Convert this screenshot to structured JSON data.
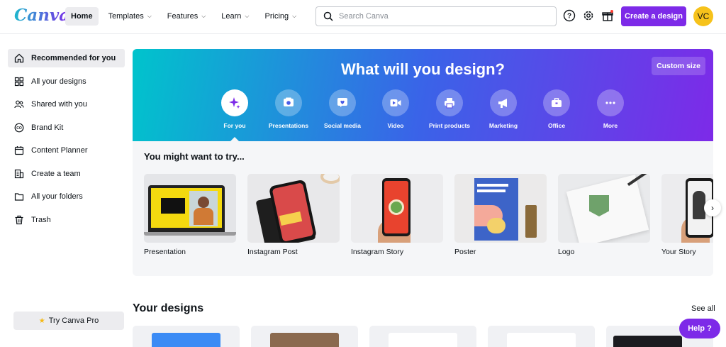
{
  "app": {
    "logo": "Canva"
  },
  "nav": [
    {
      "label": "Home",
      "dropdown": false
    },
    {
      "label": "Templates",
      "dropdown": true
    },
    {
      "label": "Features",
      "dropdown": true
    },
    {
      "label": "Learn",
      "dropdown": true
    },
    {
      "label": "Pricing",
      "dropdown": true
    }
  ],
  "search": {
    "placeholder": "Search Canva"
  },
  "header": {
    "create_label": "Create a design",
    "avatar_initials": "VC"
  },
  "sidebar": {
    "items": [
      {
        "label": "Recommended for you",
        "icon": "home-icon"
      },
      {
        "label": "All your designs",
        "icon": "grid-icon"
      },
      {
        "label": "Shared with you",
        "icon": "users-icon"
      },
      {
        "label": "Brand Kit",
        "icon": "brand-kit-icon"
      },
      {
        "label": "Content Planner",
        "icon": "calendar-icon"
      },
      {
        "label": "Create a team",
        "icon": "building-icon"
      },
      {
        "label": "All your folders",
        "icon": "folder-icon"
      },
      {
        "label": "Trash",
        "icon": "trash-icon"
      }
    ],
    "try_pro": "Try Canva Pro"
  },
  "hero": {
    "title": "What will you design?",
    "custom_size": "Custom size",
    "categories": [
      {
        "label": "For you",
        "icon": "sparkle-icon"
      },
      {
        "label": "Presentations",
        "icon": "presentation-icon"
      },
      {
        "label": "Social media",
        "icon": "heart-icon"
      },
      {
        "label": "Video",
        "icon": "video-icon"
      },
      {
        "label": "Print products",
        "icon": "printer-icon"
      },
      {
        "label": "Marketing",
        "icon": "megaphone-icon"
      },
      {
        "label": "Office",
        "icon": "briefcase-icon"
      },
      {
        "label": "More",
        "icon": "more-icon"
      }
    ]
  },
  "try": {
    "title": "You might want to try...",
    "tiles": [
      {
        "label": "Presentation"
      },
      {
        "label": "Instagram Post"
      },
      {
        "label": "Instagram Story"
      },
      {
        "label": "Poster"
      },
      {
        "label": "Logo"
      },
      {
        "label": "Your Story"
      }
    ],
    "next_label": "›"
  },
  "designs": {
    "title": "Your designs",
    "see_all": "See all"
  },
  "help": {
    "label": "Help ?"
  },
  "colors": {
    "accent": "#7d2ae8",
    "hero_start": "#00c4cc",
    "hero_end": "#7d2ae8",
    "avatar": "#f6c21b"
  }
}
